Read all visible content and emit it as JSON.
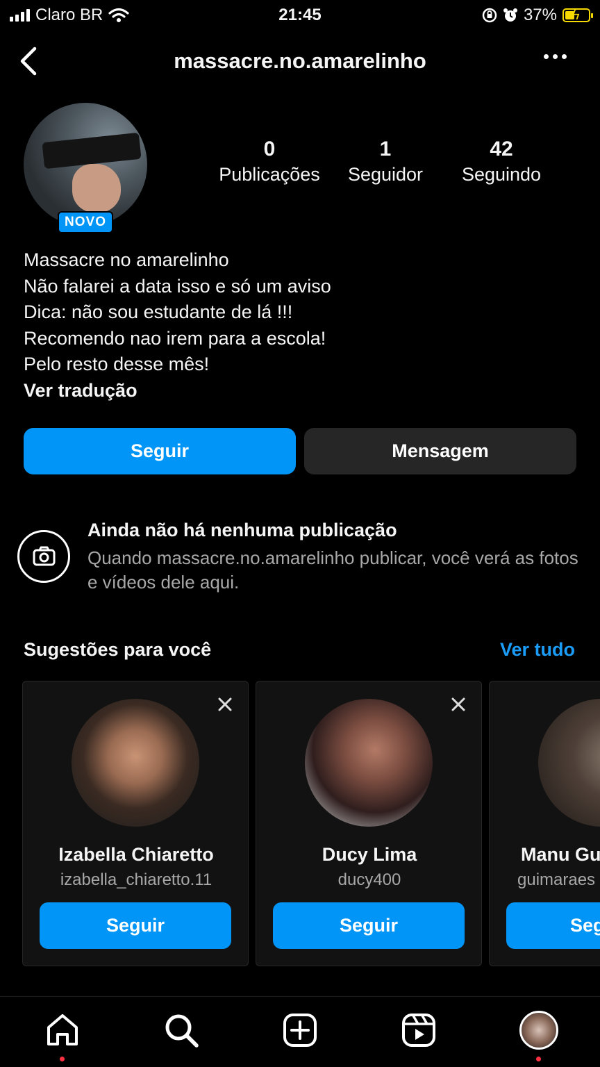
{
  "status_bar": {
    "carrier": "Claro BR",
    "time": "21:45",
    "battery": "37%"
  },
  "header": {
    "username": "massacre.no.amarelinho"
  },
  "profile": {
    "badge": "NOVO",
    "stats": [
      {
        "value": "0",
        "label": "Publicações"
      },
      {
        "value": "1",
        "label": "Seguidor"
      },
      {
        "value": "42",
        "label": "Seguindo"
      }
    ],
    "bio_lines": [
      "Massacre no amarelinho",
      "Não falarei a data isso e só um aviso",
      "Dica: não sou estudante de lá !!!",
      "Recomendo nao irem para a escola!",
      "Pelo resto desse mês!"
    ],
    "translate_label": "Ver tradução",
    "follow_label": "Seguir",
    "message_label": "Mensagem"
  },
  "empty_posts": {
    "title": "Ainda não há nenhuma publicação",
    "subtitle": "Quando massacre.no.amarelinho publicar, você verá as fotos e vídeos dele aqui."
  },
  "suggestions": {
    "title": "Sugestões para você",
    "see_all": "Ver tudo",
    "cards": [
      {
        "name": "Izabella Chiaretto",
        "username": "izabella_chiaretto.11",
        "button": "Seguir"
      },
      {
        "name": "Ducy Lima",
        "username": "ducy400",
        "button": "Seguir"
      },
      {
        "name": "Manu Gu",
        "username": "guimaraes",
        "button": "Seg"
      }
    ]
  },
  "bottom_nav": [
    "home-icon",
    "search-icon",
    "new-post-icon",
    "reels-icon",
    "profile-icon"
  ],
  "colors": {
    "accent": "#0095f6",
    "background": "#000000",
    "muted": "#a8a8a8",
    "notification": "#ff3040"
  }
}
